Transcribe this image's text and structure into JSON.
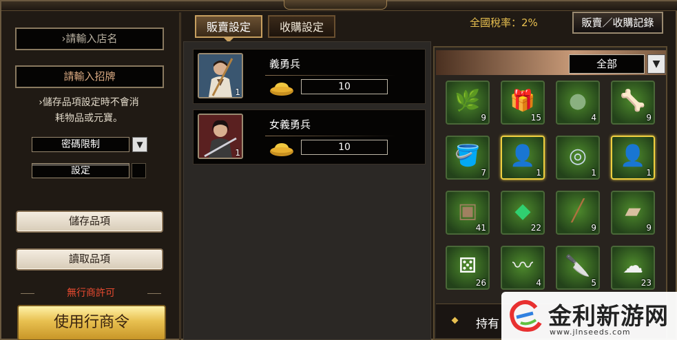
{
  "left": {
    "shop_name_placeholder": "›請輸入店名",
    "sign_placeholder": "請輸入招牌",
    "note_line1": "›儲存品項設定時不會消",
    "note_line2": "耗物品或元寶。",
    "password_select": "密碼限制",
    "set_button": "設定",
    "save_button": "儲存品項",
    "load_button": "讀取品項",
    "no_license": "無行商許可",
    "use_token_button": "使用行商令"
  },
  "tabs": [
    {
      "label": "販賣設定",
      "active": true
    },
    {
      "label": "收購設定",
      "active": false
    }
  ],
  "tax_label": "全國稅率：2%",
  "record_button": "販賣／收購記錄",
  "listings": [
    {
      "name": "義勇兵",
      "count": "1",
      "price": "10",
      "icon": "militia-soldier-portrait"
    },
    {
      "name": "女義勇兵",
      "count": "1",
      "price": "10",
      "icon": "female-militia-portrait"
    }
  ],
  "inventory": {
    "filter": "全部",
    "items": [
      {
        "icon": "herb-bundle-icon",
        "count": "9",
        "selected": false
      },
      {
        "icon": "gift-pack-icon",
        "count": "15",
        "selected": false
      },
      {
        "icon": "jade-orb-icon",
        "count": "4",
        "selected": false
      },
      {
        "icon": "bone-icon",
        "count": "9",
        "selected": false
      },
      {
        "icon": "water-bucket-icon",
        "count": "7",
        "selected": false
      },
      {
        "icon": "militia-soldier-icon",
        "count": "1",
        "selected": true
      },
      {
        "icon": "silver-bowl-icon",
        "count": "1",
        "selected": false
      },
      {
        "icon": "female-militia-icon",
        "count": "1",
        "selected": true
      },
      {
        "icon": "tea-box-icon",
        "count": "41",
        "selected": false
      },
      {
        "icon": "jade-stone-icon",
        "count": "22",
        "selected": false
      },
      {
        "icon": "wooden-rod-icon",
        "count": "9",
        "selected": false
      },
      {
        "icon": "cloth-bundle-icon",
        "count": "9",
        "selected": false
      },
      {
        "icon": "dice-icon",
        "count": "26",
        "selected": false
      },
      {
        "icon": "silk-icon",
        "count": "4",
        "selected": false
      },
      {
        "icon": "knife-icon",
        "count": "5",
        "selected": false
      },
      {
        "icon": "cotton-icon",
        "count": "23",
        "selected": false
      }
    ],
    "footer_label": "持有"
  },
  "watermark": {
    "title": "金利新游网",
    "url": "www.jlnseeds.com"
  }
}
